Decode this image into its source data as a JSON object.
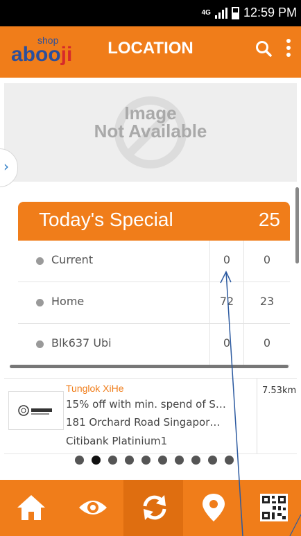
{
  "status": {
    "network": "4G",
    "time": "12:59 PM"
  },
  "appbar": {
    "logo_small": "shop",
    "logo_big": "aboo",
    "logo_tail": "ji",
    "title": "LOCATION"
  },
  "hero": {
    "line1": "Image",
    "line2": "Not Available"
  },
  "special": {
    "title": "Today's Special",
    "count": "25",
    "rows": [
      {
        "label": "Current",
        "v1": "0",
        "v2": "0"
      },
      {
        "label": "Home",
        "v1": "72",
        "v2": "23"
      },
      {
        "label": "Blk637 Ubi",
        "v1": "0",
        "v2": "0"
      }
    ]
  },
  "listing": {
    "title": "Tunglok XiHe",
    "offer": "15% off with min. spend of S…",
    "address": "181 Orchard Road Singapor…",
    "card": "Citibank Platinium1",
    "distance": "7.53km"
  },
  "pager": {
    "count": 10,
    "active": 1
  },
  "nav": [
    "home-icon",
    "eye-icon",
    "refresh-icon",
    "location-pin-icon",
    "qr-code-icon"
  ],
  "colors": {
    "accent": "#f07d1a",
    "logo": "#2b4f9c",
    "link": "#2c7cc5"
  }
}
